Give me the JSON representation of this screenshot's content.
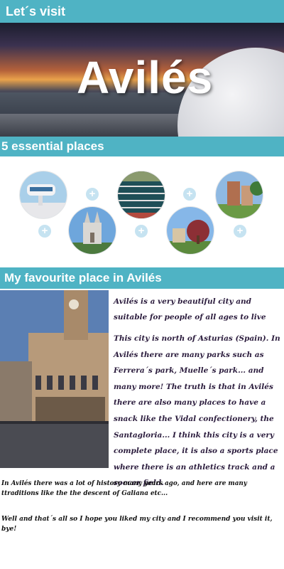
{
  "header": {
    "title": "Let´s visit"
  },
  "hero": {
    "title": "Avilés"
  },
  "essential": {
    "title": "5 essential places",
    "places": [
      {
        "icon": "niemeyer-center-photo"
      },
      {
        "icon": "church-photo"
      },
      {
        "icon": "athletics-track-photo"
      },
      {
        "icon": "park-tree-photo"
      },
      {
        "icon": "city-buildings-photo"
      }
    ],
    "plus_symbol": "+"
  },
  "favourite": {
    "title": "My favourite place in Avilés",
    "image": "town-hall-square-photo",
    "paragraph1": "Avilés is a very beautiful city and suitable for people of all ages to live",
    "paragraph2": "This city is north of Asturias (Spain). In Avilés there are many parks such as Ferrera´s park, Muelle´s park... and many more! The truth is that in Avilés there are also many places to have a snack like the Vidal confectionery, the Santagloria... I think this city is a very complete place, it is also a sports place where there is an athletics track and a soccer field."
  },
  "footer": {
    "history": "In Avilés there was a lot of history many years ago, and here are many ttraditions like the the descent of Galiana etc...",
    "closing": "Well and that´s all so I hope you liked my city and I recommend you visit it, bye!"
  },
  "colors": {
    "band": "#4fb3c4",
    "plus": "#c6e3f1",
    "text": "#2b1c3d"
  }
}
